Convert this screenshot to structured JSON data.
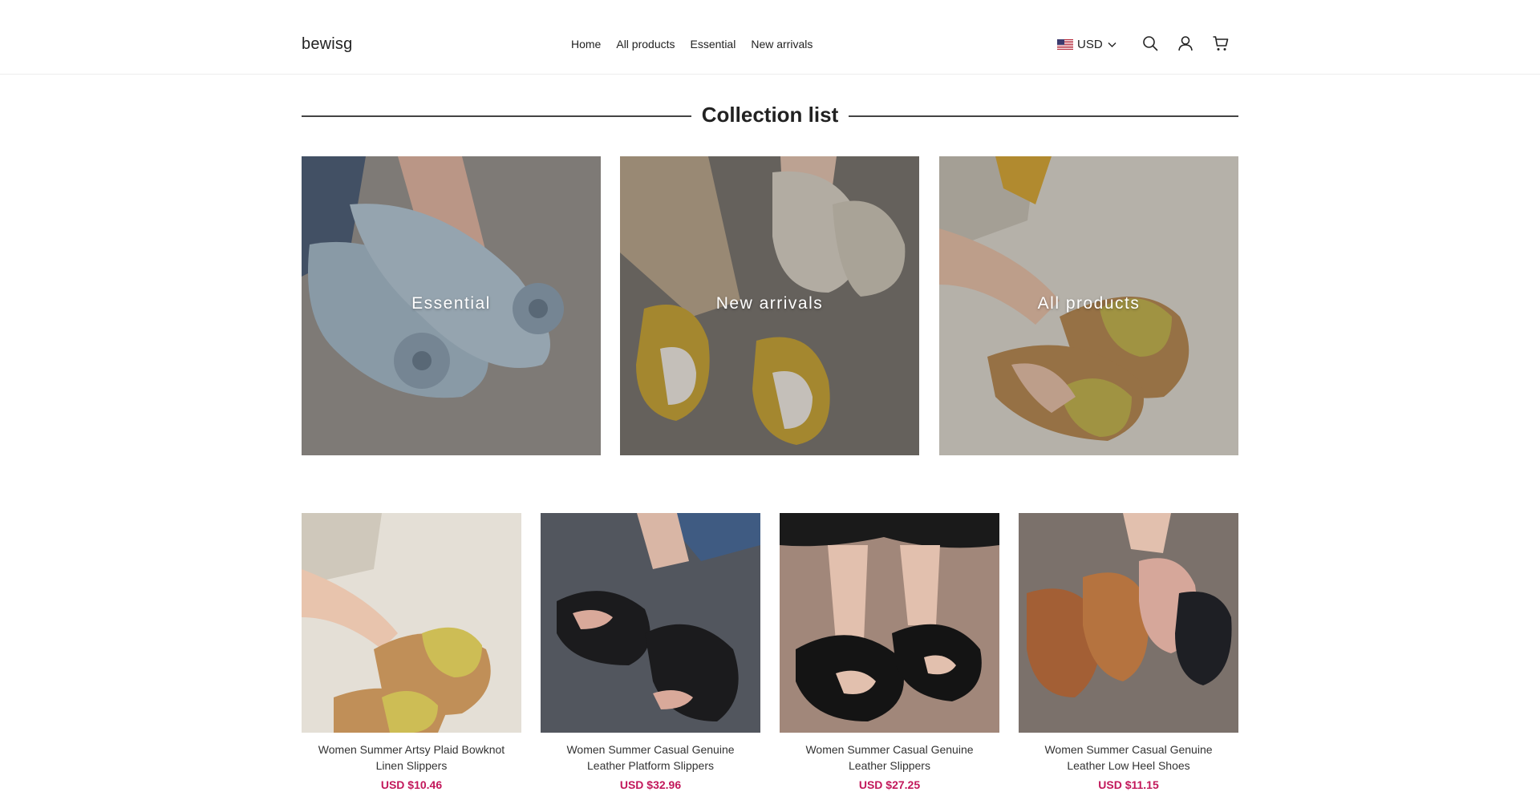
{
  "header": {
    "logo": "bewisg",
    "nav": [
      "Home",
      "All products",
      "Essential",
      "New arrivals"
    ],
    "currency": "USD",
    "icons": [
      "flag-us-icon",
      "chevron-down-icon",
      "search-icon",
      "user-icon",
      "cart-icon"
    ]
  },
  "collections": {
    "title": "Collection list",
    "items": [
      {
        "label": "Essential"
      },
      {
        "label": "New arrivals"
      },
      {
        "label": "All products"
      }
    ]
  },
  "products": [
    {
      "name": "Women Summer Artsy Plaid Bowknot Linen Slippers",
      "price": "USD $10.46"
    },
    {
      "name": "Women Summer Casual Genuine Leather Platform Slippers",
      "price": "USD $32.96"
    },
    {
      "name": "Women Summer Casual Genuine Leather Slippers",
      "price": "USD $27.25"
    },
    {
      "name": "Women Summer Casual Genuine Leather Low Heel Shoes",
      "price": "USD $11.15"
    }
  ],
  "colors": {
    "price": "#c2185b",
    "text": "#222222",
    "divider": "#ececec"
  }
}
